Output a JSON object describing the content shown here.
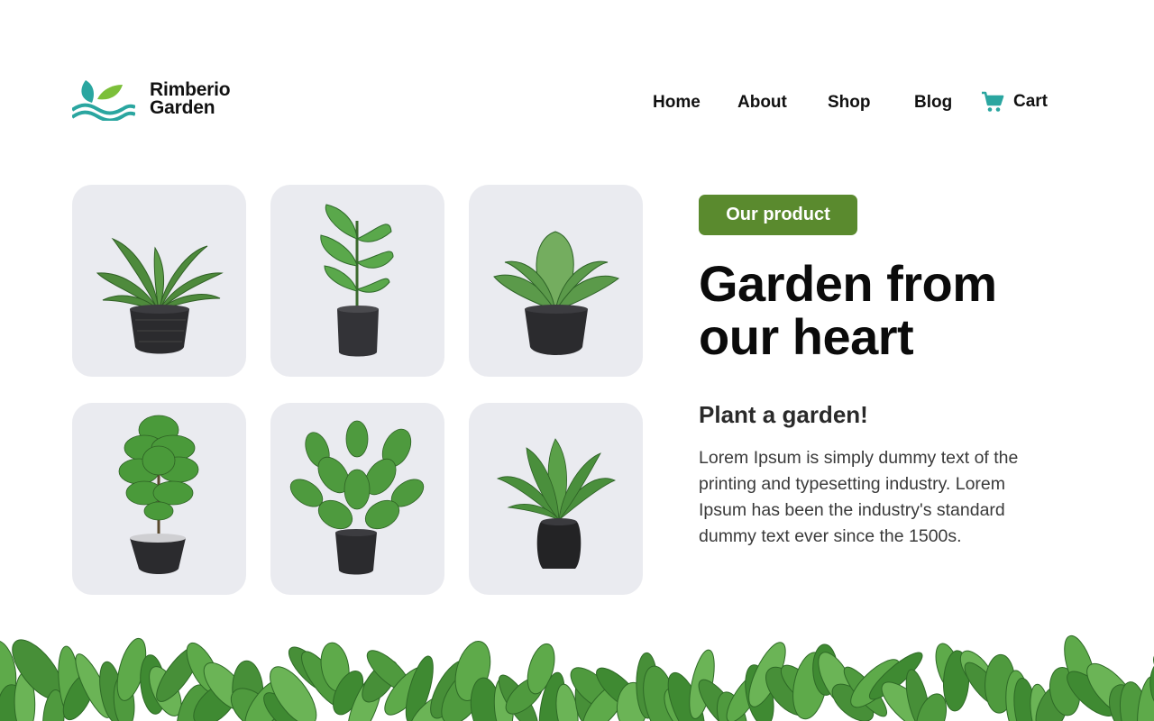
{
  "brand": {
    "line1": "Rimberio",
    "line2": "Garden",
    "logo_icon": "leaf-wave-logo-icon",
    "teal": "#2aa6a0",
    "green": "#7cbf3a"
  },
  "nav": {
    "items": [
      "Home",
      "About",
      "Shop",
      "Blog"
    ],
    "cart_label": "Cart",
    "cart_icon": "shopping-cart-icon"
  },
  "grid": {
    "tile_color": "#eaebf0",
    "plants": [
      "potted-plant-broad-leaf",
      "potted-plant-monstera",
      "potted-plant-alocasia",
      "potted-plant-fiddle-leaf",
      "potted-plant-rubber-plant",
      "potted-plant-peace-lily"
    ]
  },
  "hero": {
    "badge": "Our product",
    "badge_color": "#5a8a2e",
    "headline_line1": "Garden from",
    "headline_line2": "our heart",
    "subheading": "Plant a garden!",
    "body": "Lorem Ipsum is simply dummy text of the printing and typesetting industry. Lorem Ipsum has been the industry's standard dummy text ever since the 1500s."
  }
}
